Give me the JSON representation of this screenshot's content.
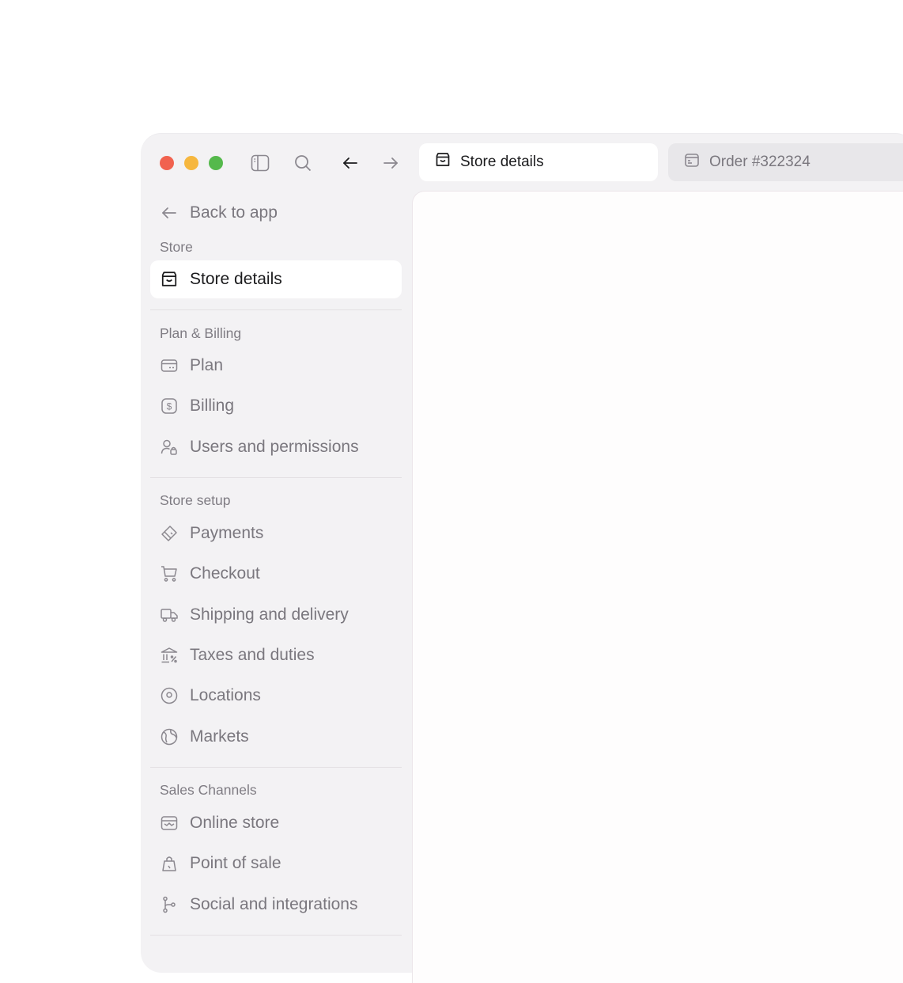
{
  "colors": {
    "traffic_close": "#f1624f",
    "traffic_minimize": "#f6b73f",
    "traffic_maximize": "#55b94c",
    "sidebar_bg": "#f3f2f4",
    "active_text": "#1b1b1d",
    "muted_text": "#7a777e"
  },
  "toolbar": {
    "icons": [
      "sidebar-toggle-icon",
      "search-icon",
      "arrow-left-icon",
      "arrow-right-icon"
    ]
  },
  "tabs": [
    {
      "label": "Store details",
      "icon": "store-icon",
      "active": true
    },
    {
      "label": "Order #322324",
      "icon": "order-icon",
      "active": false
    }
  ],
  "sidebar": {
    "back_label": "Back to app",
    "sections": [
      {
        "title": "Store",
        "items": [
          {
            "label": "Store details",
            "icon": "store-icon",
            "active": true
          }
        ]
      },
      {
        "title": "Plan & Billing",
        "items": [
          {
            "label": "Plan",
            "icon": "card-icon"
          },
          {
            "label": "Billing",
            "icon": "dollar-icon"
          },
          {
            "label": "Users and permissions",
            "icon": "user-lock-icon"
          }
        ]
      },
      {
        "title": "Store setup",
        "items": [
          {
            "label": "Payments",
            "icon": "payments-icon"
          },
          {
            "label": "Checkout",
            "icon": "cart-icon"
          },
          {
            "label": "Shipping and delivery",
            "icon": "truck-icon"
          },
          {
            "label": "Taxes and duties",
            "icon": "bank-icon"
          },
          {
            "label": "Locations",
            "icon": "location-pin-icon"
          },
          {
            "label": "Markets",
            "icon": "globe-icon"
          }
        ]
      },
      {
        "title": "Sales Channels",
        "items": [
          {
            "label": "Online store",
            "icon": "online-store-icon"
          },
          {
            "label": "Point of sale",
            "icon": "shopping-bag-icon"
          },
          {
            "label": "Social and integrations",
            "icon": "branch-icon"
          }
        ]
      }
    ]
  }
}
